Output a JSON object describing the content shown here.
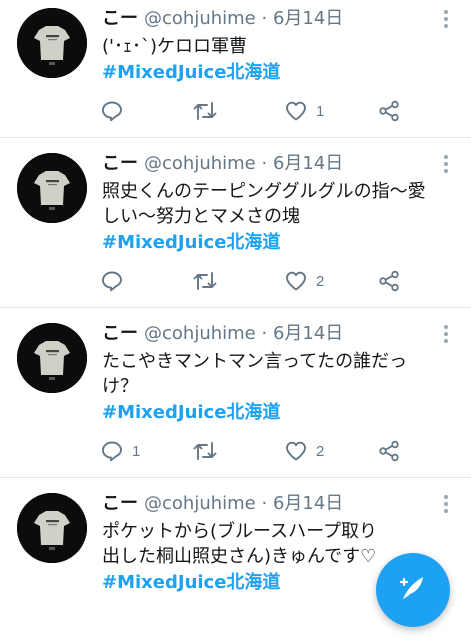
{
  "colors": {
    "accent": "#1da1f2",
    "secondary_text": "#657786",
    "divider": "#e1e8ed"
  },
  "tweets": [
    {
      "name": "こー",
      "handle": "@cohjuhime",
      "separator": "·",
      "date": "6月14日",
      "text": "('･ｪ･`)ケロロ軍曹",
      "hashtag": "#MixedJuice北海道",
      "reply_count": "",
      "retweet_count": "",
      "like_count": "1"
    },
    {
      "name": "こー",
      "handle": "@cohjuhime",
      "separator": "·",
      "date": "6月14日",
      "text": "照史くんのテーピンググルグルの指〜愛しい〜努力とマメさの塊",
      "hashtag": "#MixedJuice北海道",
      "reply_count": "",
      "retweet_count": "",
      "like_count": "2"
    },
    {
      "name": "こー",
      "handle": "@cohjuhime",
      "separator": "·",
      "date": "6月14日",
      "text": "たこやきマントマン言ってたの誰だっけ？",
      "hashtag": "#MixedJuice北海道",
      "reply_count": "1",
      "retweet_count": "",
      "like_count": "2"
    },
    {
      "name": "こー",
      "handle": "@cohjuhime",
      "separator": "·",
      "date": "6月14日",
      "text": "ポケットから(ブルースハープ取り出した桐山照史さん)きゅんです♡",
      "hashtag": "#MixedJuice北海道",
      "reply_count": "",
      "retweet_count": "",
      "like_count": ""
    }
  ],
  "icons": {
    "reply": "reply-icon",
    "retweet": "retweet-icon",
    "like": "heart-icon",
    "share": "share-icon",
    "more": "more-options-icon",
    "compose": "compose-tweet-icon"
  }
}
